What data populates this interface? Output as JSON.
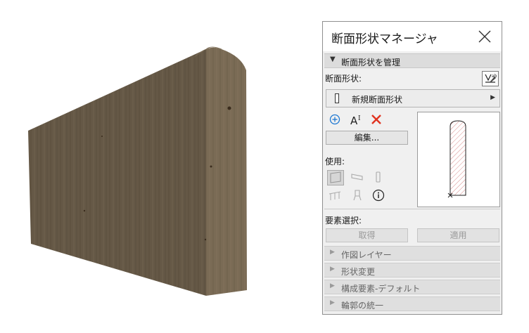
{
  "window": {
    "title": "断面形状マネージャ"
  },
  "manage_section": {
    "label": "断面形状を管理",
    "profile_label": "断面形状:",
    "selected_profile": "新規断面形状",
    "edit_button": "編集...",
    "use_label": "使用:"
  },
  "element_section": {
    "label": "要素選択:",
    "get_button": "取得",
    "apply_button": "適用"
  },
  "collapsed_sections": [
    {
      "label": "作図レイヤー"
    },
    {
      "label": "形状変更"
    },
    {
      "label": "構成要素-デフォルト"
    },
    {
      "label": "輪郭の統一"
    }
  ],
  "icons": {
    "close": "close-icon",
    "paste_profile": "paste-profile-icon",
    "add": "add-circle-icon",
    "rename": "rename-text-icon",
    "delete": "delete-x-icon",
    "wall": "wall-icon",
    "beam": "beam-icon",
    "column": "column-icon",
    "railing": "railing-icon",
    "object": "object-icon",
    "info": "info-icon"
  },
  "colors": {
    "delete": "#e0321f",
    "add": "#1e78d2",
    "hatch": "#d98c8c"
  }
}
